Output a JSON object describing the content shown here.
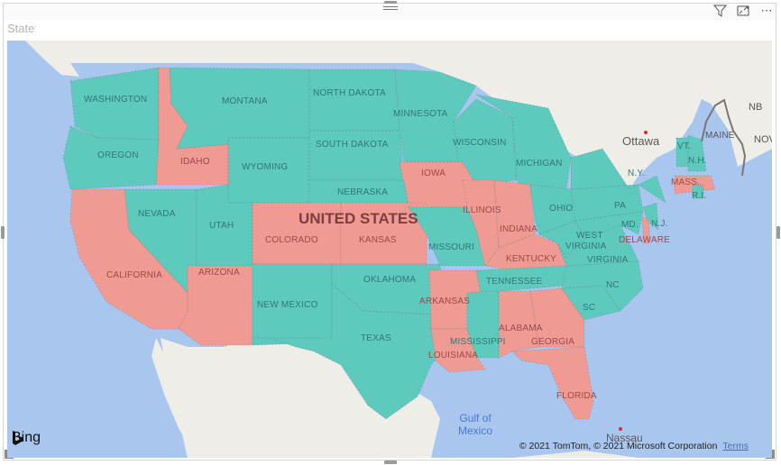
{
  "visual": {
    "title": "State",
    "toolbar": {
      "filter_icon": "filter-icon",
      "focus_mode_icon": "focus-mode-icon",
      "more_options_icon": "more-options-icon",
      "more_options_glyph": "⋯"
    }
  },
  "map": {
    "country_label": "UNITED STATES",
    "colors": {
      "teal": "#5ec9bd",
      "salmon": "#ef9a92",
      "water": "#a9c6ee",
      "land": "#efede8"
    },
    "states": [
      {
        "name": "WASHINGTON",
        "category": "teal"
      },
      {
        "name": "OREGON",
        "category": "teal"
      },
      {
        "name": "IDAHO",
        "category": "salmon"
      },
      {
        "name": "MONTANA",
        "category": "teal"
      },
      {
        "name": "WYOMING",
        "category": "teal"
      },
      {
        "name": "NORTH DAKOTA",
        "category": "teal"
      },
      {
        "name": "SOUTH DAKOTA",
        "category": "teal"
      },
      {
        "name": "MINNESOTA",
        "category": "teal"
      },
      {
        "name": "WISCONSIN",
        "category": "teal"
      },
      {
        "name": "MICHIGAN",
        "category": "teal"
      },
      {
        "name": "IOWA",
        "category": "salmon"
      },
      {
        "name": "NEBRASKA",
        "category": "teal"
      },
      {
        "name": "NEVADA",
        "category": "teal"
      },
      {
        "name": "UTAH",
        "category": "teal"
      },
      {
        "name": "COLORADO",
        "category": "salmon"
      },
      {
        "name": "KANSAS",
        "category": "salmon"
      },
      {
        "name": "CALIFORNIA",
        "category": "salmon"
      },
      {
        "name": "ARIZONA",
        "category": "salmon"
      },
      {
        "name": "NEW MEXICO",
        "category": "teal"
      },
      {
        "name": "OKLAHOMA",
        "category": "teal"
      },
      {
        "name": "TEXAS",
        "category": "teal"
      },
      {
        "name": "MISSOURI",
        "category": "teal"
      },
      {
        "name": "ILLINOIS",
        "category": "salmon"
      },
      {
        "name": "INDIANA",
        "category": "salmon"
      },
      {
        "name": "OHIO",
        "category": "teal"
      },
      {
        "name": "KENTUCKY",
        "category": "salmon"
      },
      {
        "name": "TENNESSEE",
        "category": "teal"
      },
      {
        "name": "ARKANSAS",
        "category": "salmon"
      },
      {
        "name": "LOUISIANA",
        "category": "salmon"
      },
      {
        "name": "MISSISSIPPI",
        "category": "teal"
      },
      {
        "name": "ALABAMA",
        "category": "salmon"
      },
      {
        "name": "GEORGIA",
        "category": "salmon"
      },
      {
        "name": "FLORIDA",
        "category": "salmon"
      },
      {
        "name": "SC",
        "category": "teal"
      },
      {
        "name": "NC",
        "category": "teal"
      },
      {
        "name": "VIRGINIA",
        "category": "teal"
      },
      {
        "name": "WEST VIRGINIA",
        "category": "teal"
      },
      {
        "name": "PA",
        "category": "teal"
      },
      {
        "name": "N.Y.",
        "category": "teal"
      },
      {
        "name": "MD.",
        "category": "teal"
      },
      {
        "name": "DELAWARE",
        "category": "salmon"
      },
      {
        "name": "N.J.",
        "category": "teal"
      },
      {
        "name": "VT.",
        "category": "teal"
      },
      {
        "name": "N.H.",
        "category": "teal"
      },
      {
        "name": "MASS.",
        "category": "salmon"
      },
      {
        "name": "R.I.",
        "category": "teal"
      },
      {
        "name": "MAINE",
        "category": "none"
      }
    ],
    "places": {
      "ottawa": "Ottawa",
      "nassau": "Nassau",
      "nb": "NB",
      "nova": "NOV",
      "gulf": "Gulf of Mexico"
    },
    "attribution": {
      "brand": "Bing",
      "copyright": "© 2021 TomTom, © 2021 Microsoft Corporation",
      "terms": "Terms"
    }
  }
}
